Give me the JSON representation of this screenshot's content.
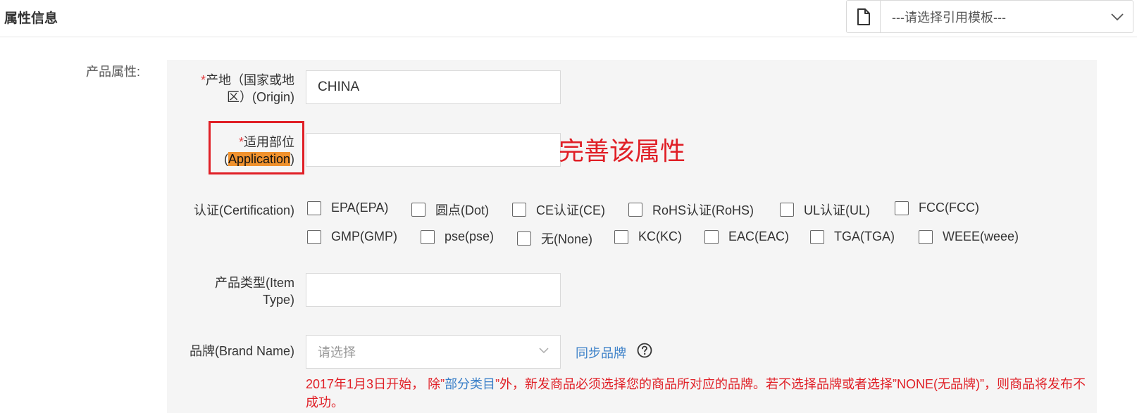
{
  "header": {
    "section_title": "属性信息",
    "template_select": {
      "value": "---请选择引用模板---",
      "icon": "document-icon",
      "arrow_icon": "chevron-down-icon"
    }
  },
  "group_label": "产品属性:",
  "fields": {
    "origin": {
      "required_mark": "*",
      "label_line1": "产地（国家或地",
      "label_line2": "区）(Origin)",
      "value": "CHINA"
    },
    "application": {
      "required_mark": "*",
      "label_line1": "适用部位",
      "label_open": "(",
      "label_highlight": "Application",
      "label_close": ")",
      "value": "",
      "annotation": "完善该属性"
    },
    "certification": {
      "label": "认证(Certification)",
      "options": [
        "EPA(EPA)",
        "圆点(Dot)",
        "CE认证(CE)",
        "RoHS认证(RoHS)",
        "UL认证(UL)",
        "FCC(FCC)",
        "GMP(GMP)",
        "pse(pse)",
        "无(None)",
        "KC(KC)",
        "EAC(EAC)",
        "TGA(TGA)",
        "WEEE(weee)"
      ]
    },
    "item_type": {
      "label_line1": "产品类型(Item",
      "label_line2": "Type)",
      "value": ""
    },
    "brand": {
      "label": "品牌(Brand Name)",
      "placeholder": "请选择",
      "sync_link": "同步品牌",
      "help_icon": "question-circle-icon",
      "notice_part1": "2017年1月3日开始， 除”",
      "notice_link": "部分类目",
      "notice_part2": "”外，新发商品必须选择您的商品所对应的品牌。若不选择品牌或者选择”NONE(无品牌)”，则商品将发布不成功。"
    }
  },
  "colors": {
    "required": "#e4393c",
    "annotation_red": "#e01f26",
    "highlight": "#f0922e",
    "link_blue": "#3a7fc8",
    "panel_bg": "#f5f5f5"
  }
}
